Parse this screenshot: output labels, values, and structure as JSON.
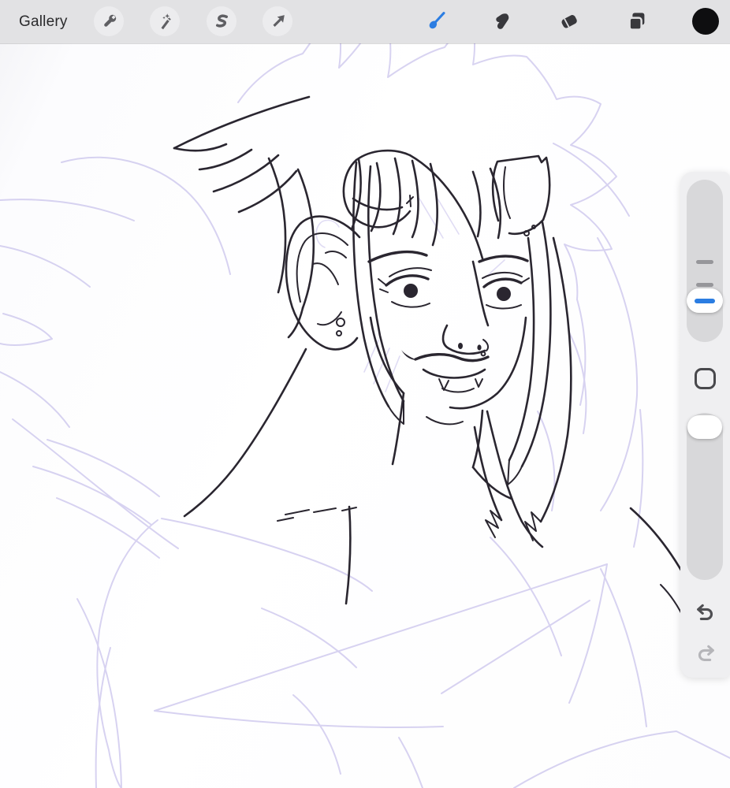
{
  "app": {
    "title": "Procreate canvas"
  },
  "colors": {
    "accent": "#2B7DE2",
    "toolbar_bg": "#E2E2E4",
    "button_bg": "#ECECEE",
    "icon_gray": "#5F5F63",
    "tool_dark": "#38383C",
    "canvas_bg": "#FDFDFF",
    "sidebar_bg": "#EFEFF1",
    "track": "#D8D8DA",
    "tick": "#96969A",
    "modify_border": "#48484C",
    "undo": "#4F4F53",
    "redo_disabled": "#B5B5B9",
    "swatch": "#0E0E10",
    "ink": "#2A2630",
    "sketch": "#B8AFE6",
    "text": "#2A2A2C"
  },
  "toolbar": {
    "gallery_label": "Gallery",
    "left_tools": [
      {
        "id": "actions",
        "icon": "wrench-icon",
        "label": "Actions"
      },
      {
        "id": "adjustments",
        "icon": "magic-wand-icon",
        "label": "Adjustments"
      },
      {
        "id": "selection",
        "icon": "selection-s-icon",
        "label": "Selection"
      },
      {
        "id": "transform",
        "icon": "transform-arrow-icon",
        "label": "Transform"
      }
    ],
    "right_tools": [
      {
        "id": "paint",
        "icon": "paintbrush-icon",
        "label": "Paint",
        "active": true
      },
      {
        "id": "smudge",
        "icon": "smudge-icon",
        "label": "Smudge",
        "active": false
      },
      {
        "id": "erase",
        "icon": "eraser-icon",
        "label": "Erase",
        "active": false
      },
      {
        "id": "layers",
        "icon": "layers-icon",
        "label": "Layers",
        "active": false
      },
      {
        "id": "color",
        "icon": "color-swatch",
        "label": "Color",
        "swatch_color": "#0E0E10",
        "active": false
      }
    ]
  },
  "sidebar": {
    "brush_size_slider": {
      "label": "Brush size",
      "value_percent": 25,
      "memory_tick_percents": [
        50,
        36
      ]
    },
    "modify_button": {
      "label": "Modify"
    },
    "opacity_slider": {
      "label": "Opacity",
      "value_percent": 100
    },
    "undo": {
      "label": "Undo",
      "disabled": false
    },
    "redo": {
      "label": "Redo",
      "disabled": true
    }
  },
  "canvas": {
    "description": "Line-art portrait of a horned character with long straight hair and pointed ear; lavender construction sketch (wing shapes, spiky hair silhouette, torso and triangle guides) beneath black ink lines.",
    "sketch_layer_color": "lavender",
    "ink_layer_color": "black"
  }
}
